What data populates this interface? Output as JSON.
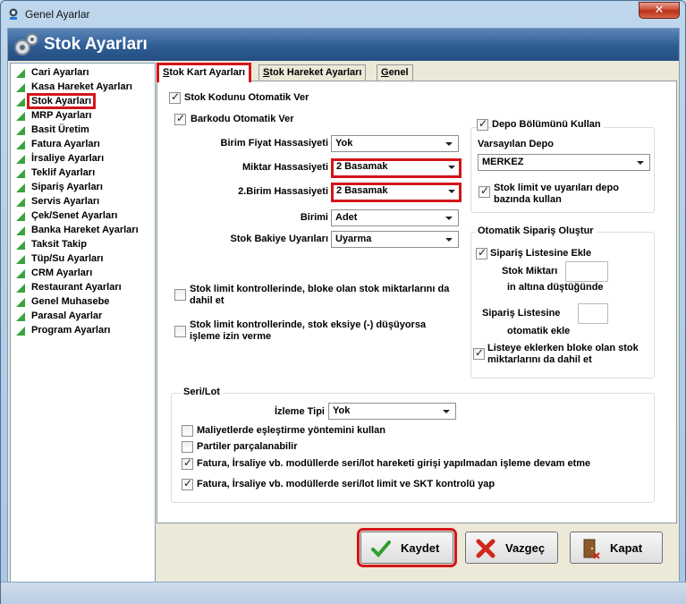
{
  "window": {
    "title": "Genel Ayarlar",
    "close_glyph": "✕"
  },
  "header": {
    "title": "Stok Ayarları",
    "icon": "gears-icon"
  },
  "sidebar": {
    "items": [
      "Cari Ayarları",
      "Kasa Hareket Ayarları",
      "Stok Ayarları",
      "MRP Ayarları",
      "Basit Üretim",
      "Fatura Ayarları",
      "İrsaliye Ayarları",
      "Teklif Ayarları",
      "Sipariş Ayarları",
      "Servis Ayarları",
      "Çek/Senet Ayarları",
      "Banka Hareket Ayarları",
      "Taksit Takip",
      "Tüp/Su Ayarları",
      "CRM Ayarları",
      "Restaurant Ayarları",
      "Genel Muhasebe",
      "Parasal Ayarlar",
      "Program Ayarları"
    ],
    "selected_index": 2
  },
  "tabs": [
    {
      "first": "S",
      "rest": "tok Kart Ayarları"
    },
    {
      "first": "S",
      "rest": "tok Hareket Ayarları"
    },
    {
      "first": "G",
      "rest": "enel"
    }
  ],
  "left": {
    "auto_code": "Stok Kodunu Otomatik Ver",
    "auto_barcode": "Barkodu Otomatik Ver",
    "unit_price_precision_label": "Birim Fiyat Hassasiyeti",
    "unit_price_precision_value": "Yok",
    "qty_precision_label": "Miktar Hassasiyeti",
    "qty_precision_value": "2 Basamak",
    "unit2_precision_label": "2.Birim Hassasiyeti",
    "unit2_precision_value": "2 Basamak",
    "unit_label": "Birimi",
    "unit_value": "Adet",
    "balance_warning_label": "Stok Bakiye Uyarıları",
    "balance_warning_value": "Uyarma",
    "limit_blocked": "Stok limit kontrollerinde, bloke olan stok miktarlarını da dahil et",
    "limit_negative": "Stok limit kontrollerinde, stok eksiye (-) düşüyorsa işleme izin verme"
  },
  "right": {
    "use_depot": "Depo Bölümünü Kullan",
    "default_depot_label": "Varsayılan Depo",
    "default_depot_value": "MERKEZ",
    "depot_based_limit": "Stok limit ve uyarıları depo bazında kullan",
    "auto_order_title": "Otomatik Sipariş Oluştur",
    "add_to_order_list": "Sipariş Listesine Ekle",
    "stock_qty_label": "Stok Miktarı",
    "below_label": "in altına düştüğünde",
    "order_list_label": "Sipariş Listesine",
    "auto_add_label": "otomatik ekle",
    "include_blocked": "Listeye eklerken bloke olan stok miktarlarını da dahil et"
  },
  "serial": {
    "title": "Seri/Lot",
    "tracking_label": "İzleme Tipi",
    "tracking_value": "Yok",
    "cost_matching": "Maliyetlerde eşleştirme yöntemini kullan",
    "split_lots": "Partiler parçalanabilir",
    "no_serial_move": "Fatura, İrsaliye vb. modüllerde seri/lot hareketi girişi yapılmadan işleme devam etme",
    "serial_limit": "Fatura, İrsaliye vb. modüllerde seri/lot limit ve SKT kontrolü yap"
  },
  "buttons": {
    "save": "Kaydet",
    "cancel": "Vazgeç",
    "close": "Kapat"
  },
  "colors": {
    "highlight": "#d4141a",
    "header": "#2e5d94",
    "tree_marker": "#39a33e"
  }
}
